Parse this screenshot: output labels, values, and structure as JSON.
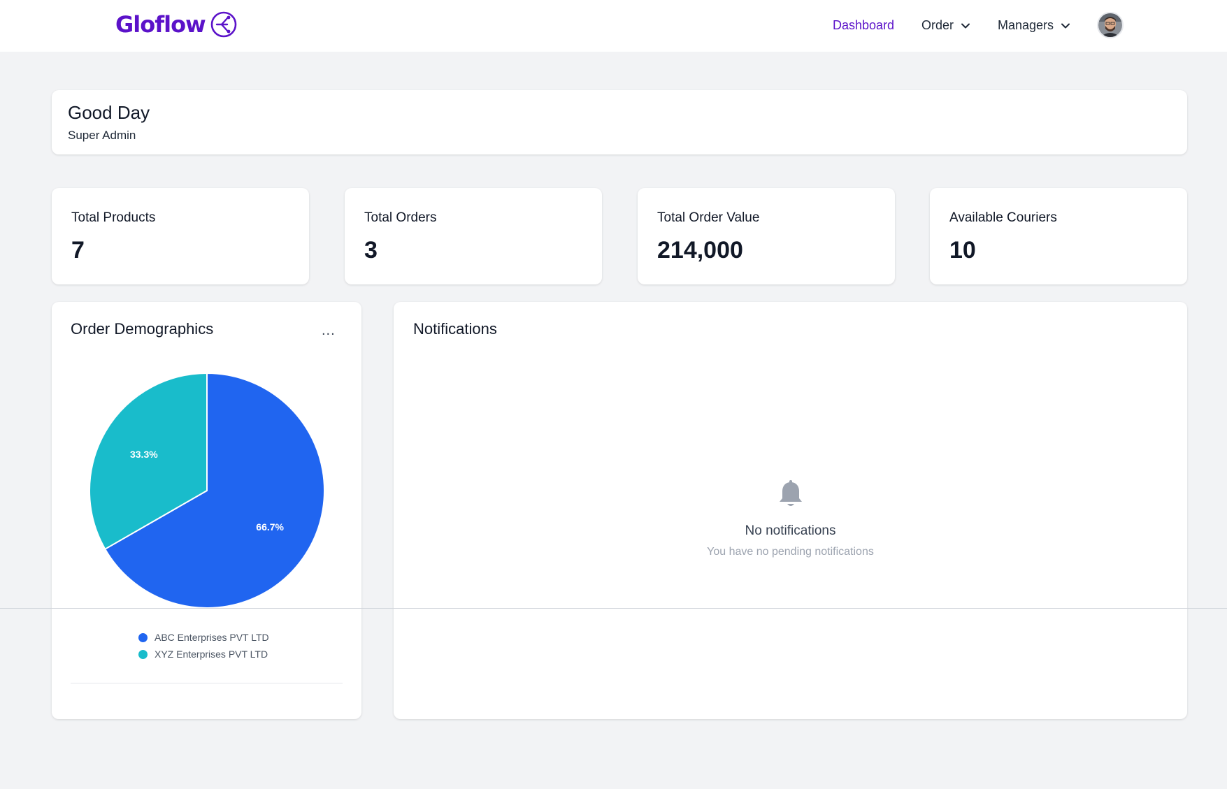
{
  "brand": {
    "name": "Gloflow",
    "color": "#5b12c9"
  },
  "nav": {
    "dashboard": "Dashboard",
    "order": "Order",
    "managers": "Managers"
  },
  "greeting": {
    "title": "Good Day",
    "subtitle": "Super Admin"
  },
  "stats": [
    {
      "label": "Total Products",
      "value": "7"
    },
    {
      "label": "Total Orders",
      "value": "3"
    },
    {
      "label": "Total Order Value",
      "value": "214,000"
    },
    {
      "label": "Available Couriers",
      "value": "10"
    }
  ],
  "demographics": {
    "title": "Order Demographics",
    "menu_label": "..."
  },
  "notifications": {
    "title": "Notifications",
    "empty_title": "No notifications",
    "empty_subtitle": "You have no pending notifications"
  },
  "chart_data": {
    "type": "pie",
    "title": "Order Demographics",
    "categories": [
      "ABC Enterprises PVT LTD",
      "XYZ Enterprises PVT LTD"
    ],
    "values": [
      66.7,
      33.3
    ],
    "labels": [
      "66.7%",
      "33.3%"
    ],
    "colors": [
      "#2065f0",
      "#19bccb"
    ],
    "legend_position": "bottom"
  }
}
